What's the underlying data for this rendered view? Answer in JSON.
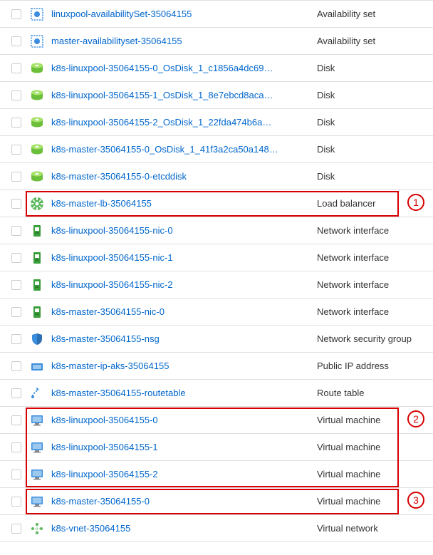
{
  "resources": [
    {
      "name": "linuxpool-availabilitySet-35064155",
      "type": "Availability set",
      "icon": "availability-set"
    },
    {
      "name": "master-availabilityset-35064155",
      "type": "Availability set",
      "icon": "availability-set"
    },
    {
      "name": "k8s-linuxpool-35064155-0_OsDisk_1_c1856a4dc69…",
      "type": "Disk",
      "icon": "disk"
    },
    {
      "name": "k8s-linuxpool-35064155-1_OsDisk_1_8e7ebcd8aca…",
      "type": "Disk",
      "icon": "disk"
    },
    {
      "name": "k8s-linuxpool-35064155-2_OsDisk_1_22fda474b6a…",
      "type": "Disk",
      "icon": "disk"
    },
    {
      "name": "k8s-master-35064155-0_OsDisk_1_41f3a2ca50a148…",
      "type": "Disk",
      "icon": "disk"
    },
    {
      "name": "k8s-master-35064155-0-etcddisk",
      "type": "Disk",
      "icon": "disk"
    },
    {
      "name": "k8s-master-lb-35064155",
      "type": "Load balancer",
      "icon": "load-balancer"
    },
    {
      "name": "k8s-linuxpool-35064155-nic-0",
      "type": "Network interface",
      "icon": "nic"
    },
    {
      "name": "k8s-linuxpool-35064155-nic-1",
      "type": "Network interface",
      "icon": "nic"
    },
    {
      "name": "k8s-linuxpool-35064155-nic-2",
      "type": "Network interface",
      "icon": "nic"
    },
    {
      "name": "k8s-master-35064155-nic-0",
      "type": "Network interface",
      "icon": "nic"
    },
    {
      "name": "k8s-master-35064155-nsg",
      "type": "Network security group",
      "icon": "nsg"
    },
    {
      "name": "k8s-master-ip-aks-35064155",
      "type": "Public IP address",
      "icon": "public-ip"
    },
    {
      "name": "k8s-master-35064155-routetable",
      "type": "Route table",
      "icon": "route-table"
    },
    {
      "name": "k8s-linuxpool-35064155-0",
      "type": "Virtual machine",
      "icon": "vm"
    },
    {
      "name": "k8s-linuxpool-35064155-1",
      "type": "Virtual machine",
      "icon": "vm"
    },
    {
      "name": "k8s-linuxpool-35064155-2",
      "type": "Virtual machine",
      "icon": "vm"
    },
    {
      "name": "k8s-master-35064155-0",
      "type": "Virtual machine",
      "icon": "vm"
    },
    {
      "name": "k8s-vnet-35064155",
      "type": "Virtual network",
      "icon": "vnet"
    }
  ],
  "highlights": [
    {
      "rows": [
        7
      ],
      "callout": "1"
    },
    {
      "rows": [
        15,
        16,
        17
      ],
      "callout": "2"
    },
    {
      "rows": [
        18
      ],
      "callout": "3"
    }
  ]
}
